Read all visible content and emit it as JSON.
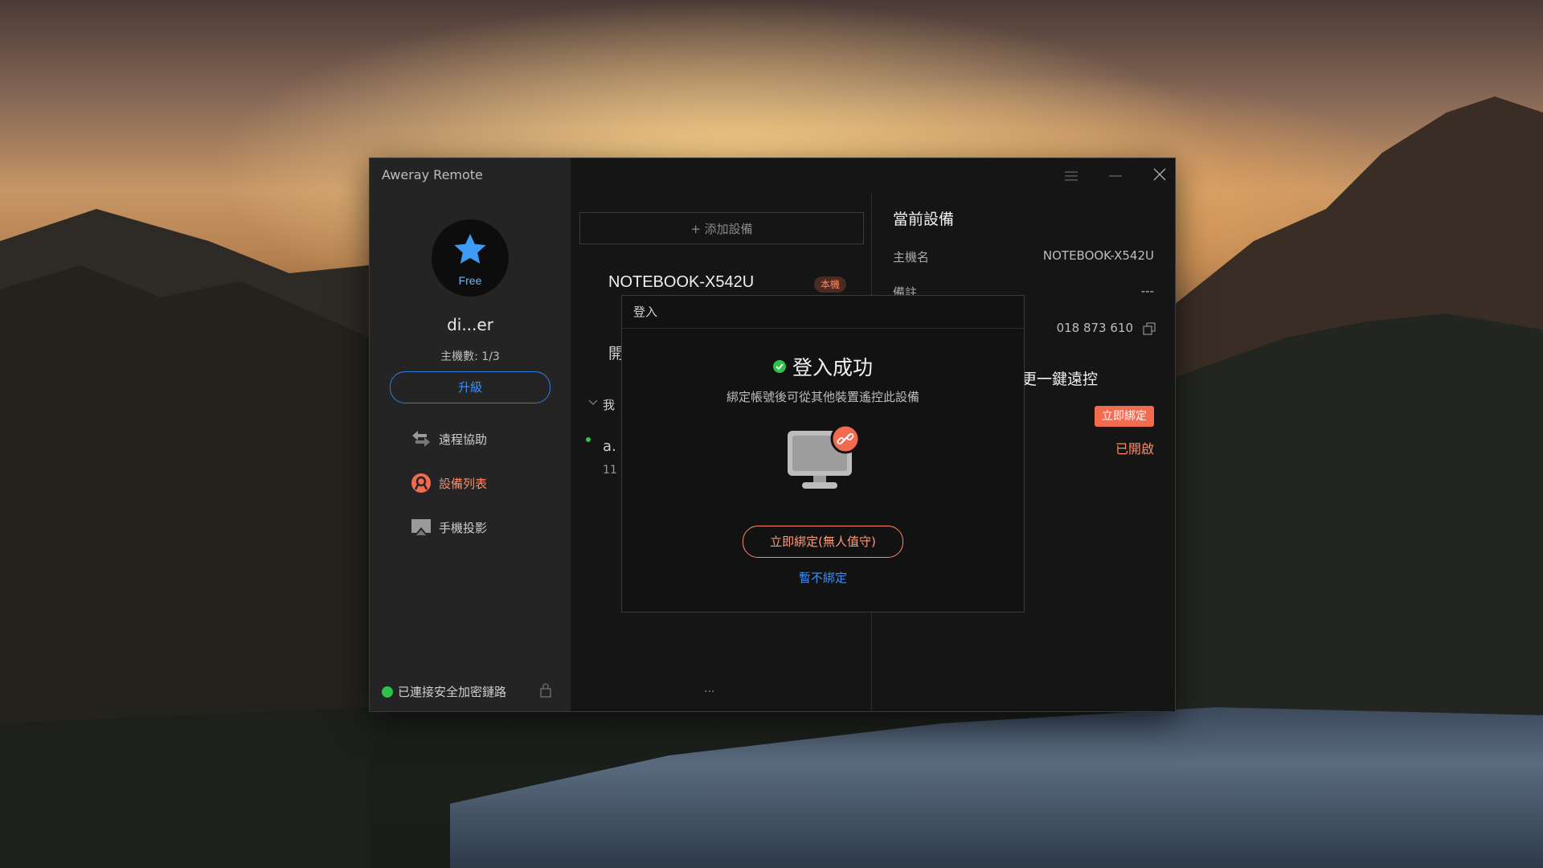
{
  "window": {
    "app_title": "Aweray Remote"
  },
  "sidebar": {
    "avatar_plan": "Free",
    "username": "di...er",
    "host_count": "主機數: 1/3",
    "upgrade_label": "升級",
    "nav": [
      {
        "label": "遠程協助",
        "icon": "remote-assist-icon"
      },
      {
        "label": "設備列表",
        "icon": "device-list-icon",
        "active": true
      },
      {
        "label": "手機投影",
        "icon": "screen-cast-icon"
      }
    ],
    "connection_status": "已連接安全加密鏈路",
    "accent_color": "#ff8a65",
    "status_color": "#2ec24a"
  },
  "middle": {
    "add_device_label": "+ 添加設備",
    "device_name": "NOTEBOOK-X542U",
    "local_badge": "本機",
    "frag_open": "開",
    "frag_my": "我",
    "frag_a": "a.",
    "frag_11": "11",
    "more_dots": "..."
  },
  "right_panel": {
    "title": "當前設備",
    "hostname_label": "主機名",
    "hostname_value": "NOTEBOOK-X542U",
    "note_label": "備註",
    "note_value": "---",
    "device_id": "018 873 610",
    "one_click_fragment": "更一鍵遠控",
    "bind_now_label": "立即綁定",
    "enabled_label": "已開啟"
  },
  "dialog": {
    "title": "登入",
    "success_text": "登入成功",
    "description": "綁定帳號後可從其他裝置遙控此設備",
    "bind_button": "立即綁定(無人值守)",
    "skip_link": "暫不綁定"
  }
}
